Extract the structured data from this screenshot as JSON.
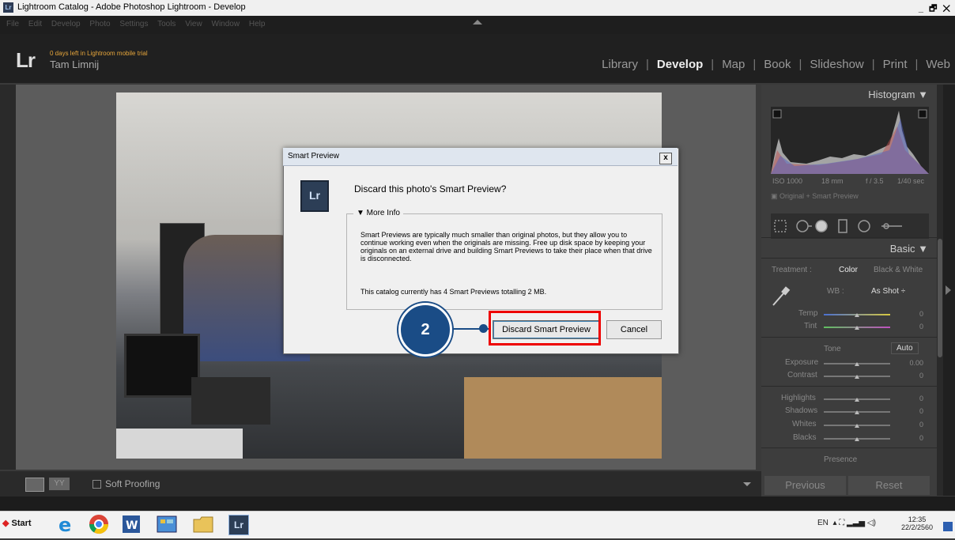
{
  "window": {
    "title": "Lightroom Catalog - Adobe Photoshop Lightroom - Develop",
    "controls": "_ 🗗 ✕"
  },
  "menu": [
    "File",
    "Edit",
    "Develop",
    "Photo",
    "Settings",
    "Tools",
    "View",
    "Window",
    "Help"
  ],
  "identity": {
    "logo": "Lr",
    "trial": "0 days left in Lightroom mobile trial",
    "user": "Tam Limnij"
  },
  "modules": [
    "Library",
    "Develop",
    "Map",
    "Book",
    "Slideshow",
    "Print",
    "Web"
  ],
  "active_module": "Develop",
  "right_panel": {
    "histogram_title": "Histogram",
    "exif": {
      "iso": "ISO 1000",
      "focal": "18 mm",
      "aperture": "f / 3.5",
      "shutter": "1/40 sec"
    },
    "preview_state": "Original + Smart Preview",
    "basic_title": "Basic",
    "treatment_label": "Treatment :",
    "treatment_color": "Color",
    "treatment_bw": "Black & White",
    "wb_label": "WB :",
    "wb_value": "As Shot ÷",
    "temp_label": "Temp",
    "temp_value": "0",
    "tint_label": "Tint",
    "tint_value": "0",
    "tone_label": "Tone",
    "auto_label": "Auto",
    "exposure_label": "Exposure",
    "exposure_value": "0.00",
    "contrast_label": "Contrast",
    "contrast_value": "0",
    "highlights_label": "Highlights",
    "highlights_value": "0",
    "shadows_label": "Shadows",
    "shadows_value": "0",
    "whites_label": "Whites",
    "whites_value": "0",
    "blacks_label": "Blacks",
    "blacks_value": "0",
    "presence_label": "Presence",
    "previous_label": "Previous",
    "reset_label": "Reset"
  },
  "bottom": {
    "soft_proofing": "Soft Proofing",
    "yy": "YY"
  },
  "dialog": {
    "title": "Smart Preview",
    "close": "x",
    "logo": "Lr",
    "question": "Discard this photo's Smart Preview?",
    "more_info": "▼  More Info",
    "info_text": "Smart Previews are typically much smaller than original photos, but they allow you to continue working even when the originals are missing. Free up disk space by keeping your originals on an external drive and building Smart Previews to take their place when that drive is disconnected.",
    "count_text": "This catalog currently has 4 Smart Previews totalling 2 MB.",
    "discard_label": "Discard Smart Preview",
    "cancel_label": "Cancel"
  },
  "step_marker": "2",
  "taskbar": {
    "start": "Start",
    "lang": "EN",
    "time": "12:35",
    "date": "22/2/2560",
    "lr_icon": "Lr"
  }
}
